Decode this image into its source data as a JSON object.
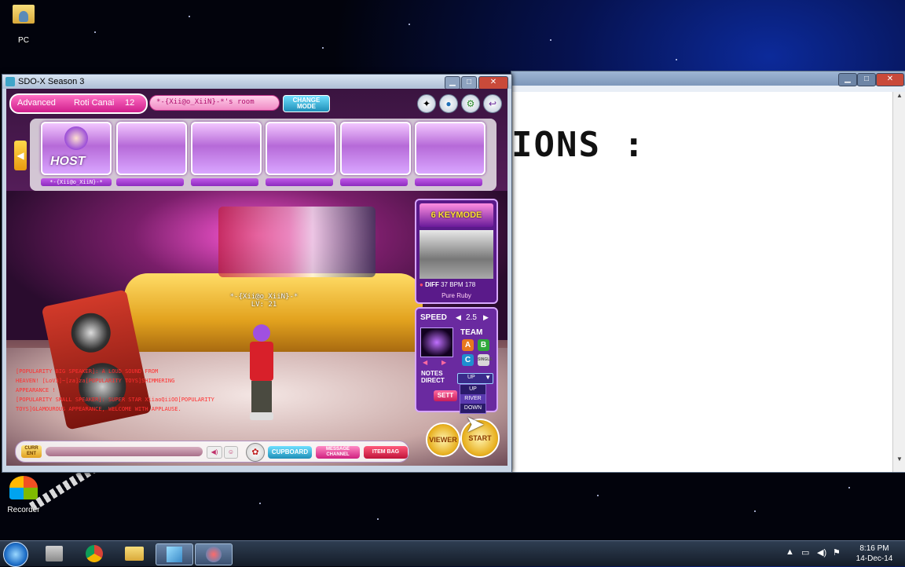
{
  "desktop": {
    "icons": [
      {
        "label": "PC"
      },
      {
        "label": "Recorder"
      }
    ]
  },
  "notepad": {
    "visible_text": "IONS :"
  },
  "game_window": {
    "title": "SDO-X Season 3",
    "mode": "Advanced",
    "server": "Roti Canai",
    "room_number": "12",
    "room_name": "*-{Xii@o_XiiN}-*'s room",
    "change_mode_label": "CHANGE\nMODE",
    "host_badge": "HOST",
    "host_name": "*-{Xii@o_XiiN}-*",
    "player_name": "*-{Xii@o_XiiN}-*",
    "player_level": "LV: 21",
    "keymode_label": "6 KEYMODE",
    "song_diff_label": "DIFF",
    "song_diff_value": "37",
    "song_bpm_label": "BPM",
    "song_bpm_value": "178",
    "song_name": "Pure Ruby",
    "speed_label": "SPEED",
    "speed_value": "2.5",
    "team_label": "TEAM",
    "team_buttons": [
      "A",
      "B",
      "C",
      "SINGLE"
    ],
    "notes_direct_label": "NOTES\nDIRECT",
    "notes_direction_selected": "UP",
    "notes_direction_options": [
      "UP",
      "RIVER",
      "DOWN"
    ],
    "setting_label": "SETT",
    "viewer_label": "VIEWER",
    "start_label": "START",
    "chat_lines": [
      "[POPULARITY BIG SPEAKER]: A LOUD SOUND FROM",
      "HEAVEN! [LoV3]~[za]za[POPULARITY TOYS]SHIMMERING",
      "APPEARANCE !",
      "[POPULARITY SMALL SPEAKER]: SUPER STAR XiiaoQiiOO[POPULARITY",
      "TOYS]GLAMOUROUS APPEARANCE, WELCOME WITH APPLAUSE."
    ],
    "bottom_bar": {
      "current_label": "CURR\nENT",
      "cupboard_label": "CUPBOARD",
      "message_channel_label": "MESSAGE\nCHANNEL",
      "item_bag_label": "ITEM BAG"
    }
  },
  "taskbar": {
    "clock_time": "8:16 PM",
    "clock_date": "14-Dec-14"
  },
  "colors": {
    "game_accent_pink": "#e0309a",
    "game_accent_purple": "#8d2cbf",
    "cyan_button": "#1fa6c8",
    "chat_red": "#ff3030"
  }
}
